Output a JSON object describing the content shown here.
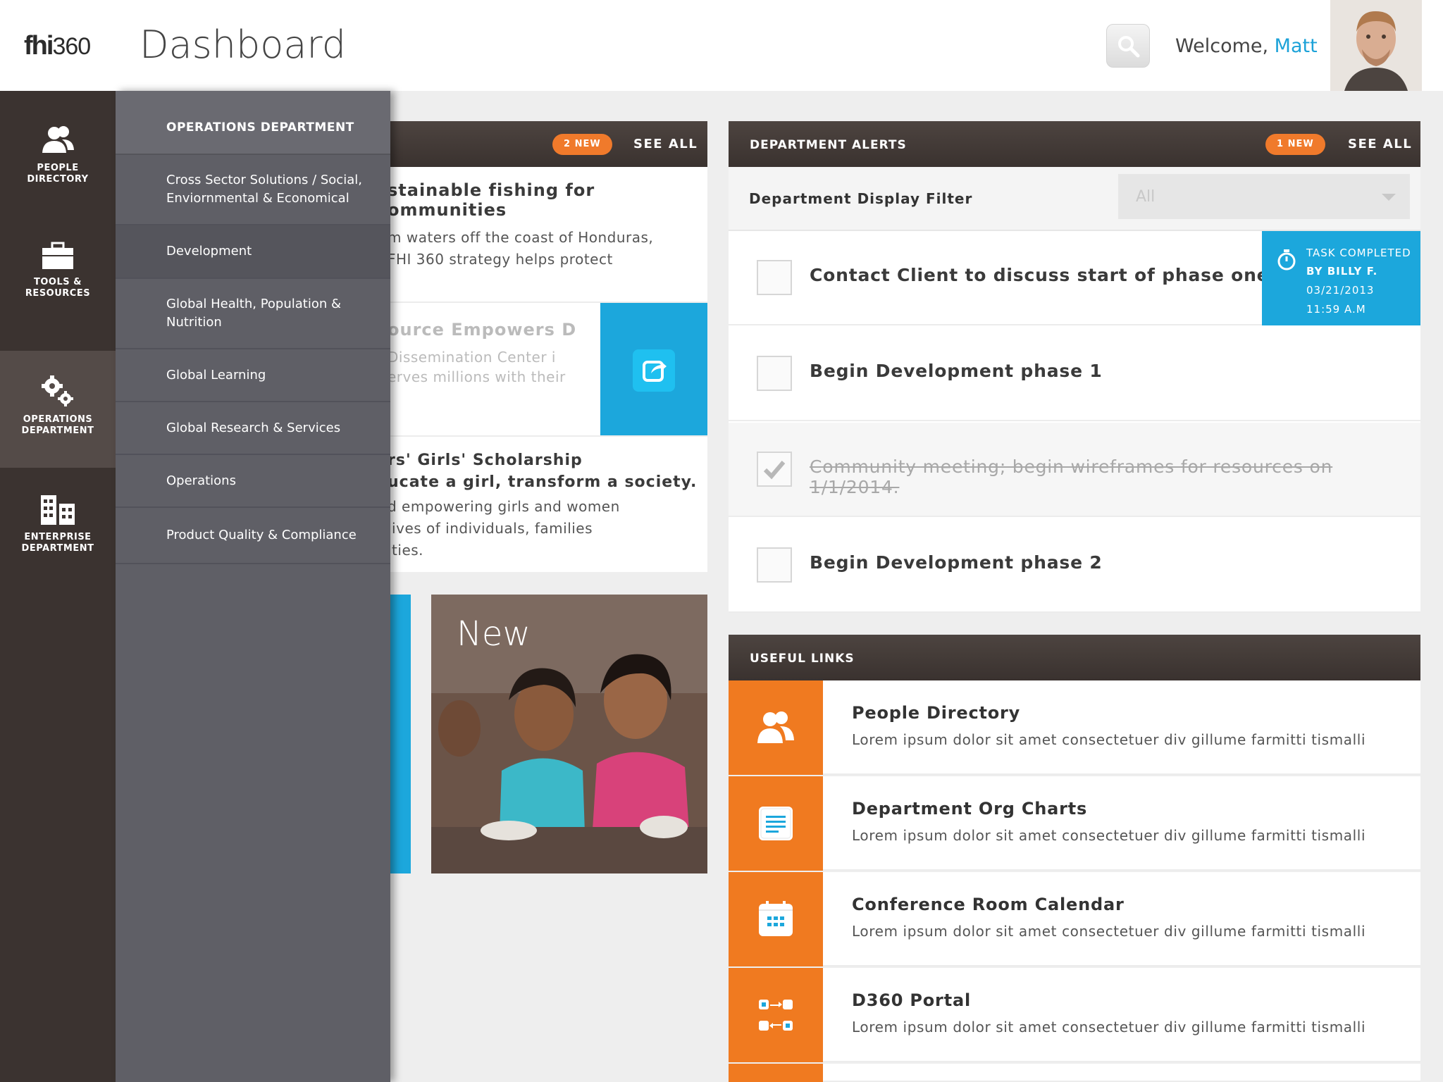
{
  "header": {
    "logo_main": "fhi",
    "logo_num": "360",
    "title": "Dashboard",
    "welcome_prefix": "Welcome, ",
    "user_name": "Matt"
  },
  "rail": {
    "items": [
      {
        "label": "PEOPLE DIRECTORY",
        "icon": "people-icon"
      },
      {
        "label": "TOOLS & RESOURCES",
        "icon": "briefcase-icon"
      },
      {
        "label": "OPERATIONS DEPARTMENT",
        "icon": "gears-icon",
        "active": true
      },
      {
        "label": "ENTERPRISE DEPARTMENT",
        "icon": "buildings-icon"
      }
    ]
  },
  "submenu": {
    "heading": "OPERATIONS DEPARTMENT",
    "items": [
      "Cross Sector Solutions / Social, Enviornmental & Economical",
      "Development",
      "Global Health, Population & Nutrition",
      "Global Learning",
      "Global Research & Services",
      "Operations",
      "Product Quality & Compliance"
    ]
  },
  "news": {
    "badge": "2 NEW",
    "see_all": "SEE ALL",
    "item1_title_a": "stainable fishing for",
    "item1_title_b": "ommunities",
    "item1_text_a": "m waters off the coast of Honduras,",
    "item1_text_b": " FHI 360 strategy helps protect",
    "item2_title": "ource Empowers D",
    "item2_text_a": "Dissemination Center i",
    "item2_text_b": "erves millions with their",
    "item3_title_a": "rs' Girls' Scholarship",
    "item3_title_b": "ucate a girl, transform a society.",
    "item3_text_a": "d empowering girls and women",
    "item3_text_b": "lives of individuals, families",
    "item3_text_c": "ities.",
    "photo_label": "New"
  },
  "alerts": {
    "title": "DEPARTMENT ALERTS",
    "badge": "1 NEW",
    "see_all": "SEE ALL",
    "filter_label": "Department Display Filter",
    "filter_value": "All",
    "tasks": [
      {
        "label": "Contact Client to discuss start of phase one",
        "done": false
      },
      {
        "label": "Begin Development phase 1",
        "done": false
      },
      {
        "label": "Community meeting; begin wireframes for resources on 1/1/2014.",
        "done": true
      },
      {
        "label": "Begin Development phase 2",
        "done": false
      }
    ],
    "completed": {
      "line1": "TASK COMPLETED",
      "line2": "BY BILLY F.",
      "date": "03/21/2013",
      "time": "11:59 A.M"
    }
  },
  "links": {
    "title": "USEFUL LINKS",
    "items": [
      {
        "title": "People Directory",
        "desc": "Lorem ipsum dolor sit amet consectetuer div gillume farmitti tismalli",
        "icon": "people-icon"
      },
      {
        "title": "Department Org Charts",
        "desc": "Lorem ipsum dolor sit amet consectetuer div gillume farmitti tismalli",
        "icon": "document-icon"
      },
      {
        "title": "Conference Room Calendar",
        "desc": "Lorem ipsum dolor sit amet consectetuer div gillume farmitti tismalli",
        "icon": "calendar-icon"
      },
      {
        "title": "D360 Portal",
        "desc": "Lorem ipsum dolor sit amet consectetuer div gillume farmitti tismalli",
        "icon": "portal-icon"
      }
    ]
  },
  "colors": {
    "accent_blue": "#1ca7dc",
    "accent_orange": "#f07a20",
    "rail_bg": "#3b3330",
    "submenu_bg": "#5f5f66"
  }
}
